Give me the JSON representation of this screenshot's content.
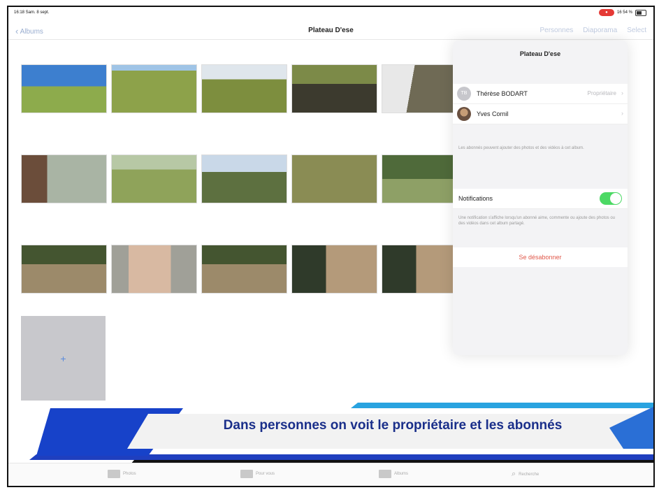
{
  "status": {
    "time": "16:18  Sam. 8 sept.",
    "battery": "16 54 %",
    "recording": "●"
  },
  "nav": {
    "back_label": "Albums",
    "title": "Plateau D'ese",
    "actions": [
      "Personnes",
      "Diaporama",
      "Select"
    ]
  },
  "add_tile": {
    "label": "+"
  },
  "panel": {
    "title": "Plateau D'ese",
    "owner": {
      "initials": "TB",
      "name": "Thérèse BODART",
      "role": "Propriétaire"
    },
    "subscriber": {
      "name": "Yves Cornil"
    },
    "subscribers_note": "Les abonnés peuvent ajouter des photos et des vidéos à cet album.",
    "notifications_label": "Notifications",
    "notifications_on": true,
    "notifications_note": "Une notification s'affiche lorsqu'un abonné aime, commente ou ajoute des photos ou des vidéos dans cet album partagé.",
    "unsubscribe_label": "Se désabonner"
  },
  "caption": "Dans personnes on voit le propriétaire et les abonnés",
  "tabs": [
    {
      "label": "Photos"
    },
    {
      "label": "Pour vous"
    },
    {
      "label": "Albums"
    },
    {
      "label": "Recherche"
    }
  ],
  "colors": {
    "accent": "#5b8bdc",
    "toggle_on": "#4cd964",
    "destructive": "#e0584a",
    "caption_text": "#1a2f8a"
  }
}
